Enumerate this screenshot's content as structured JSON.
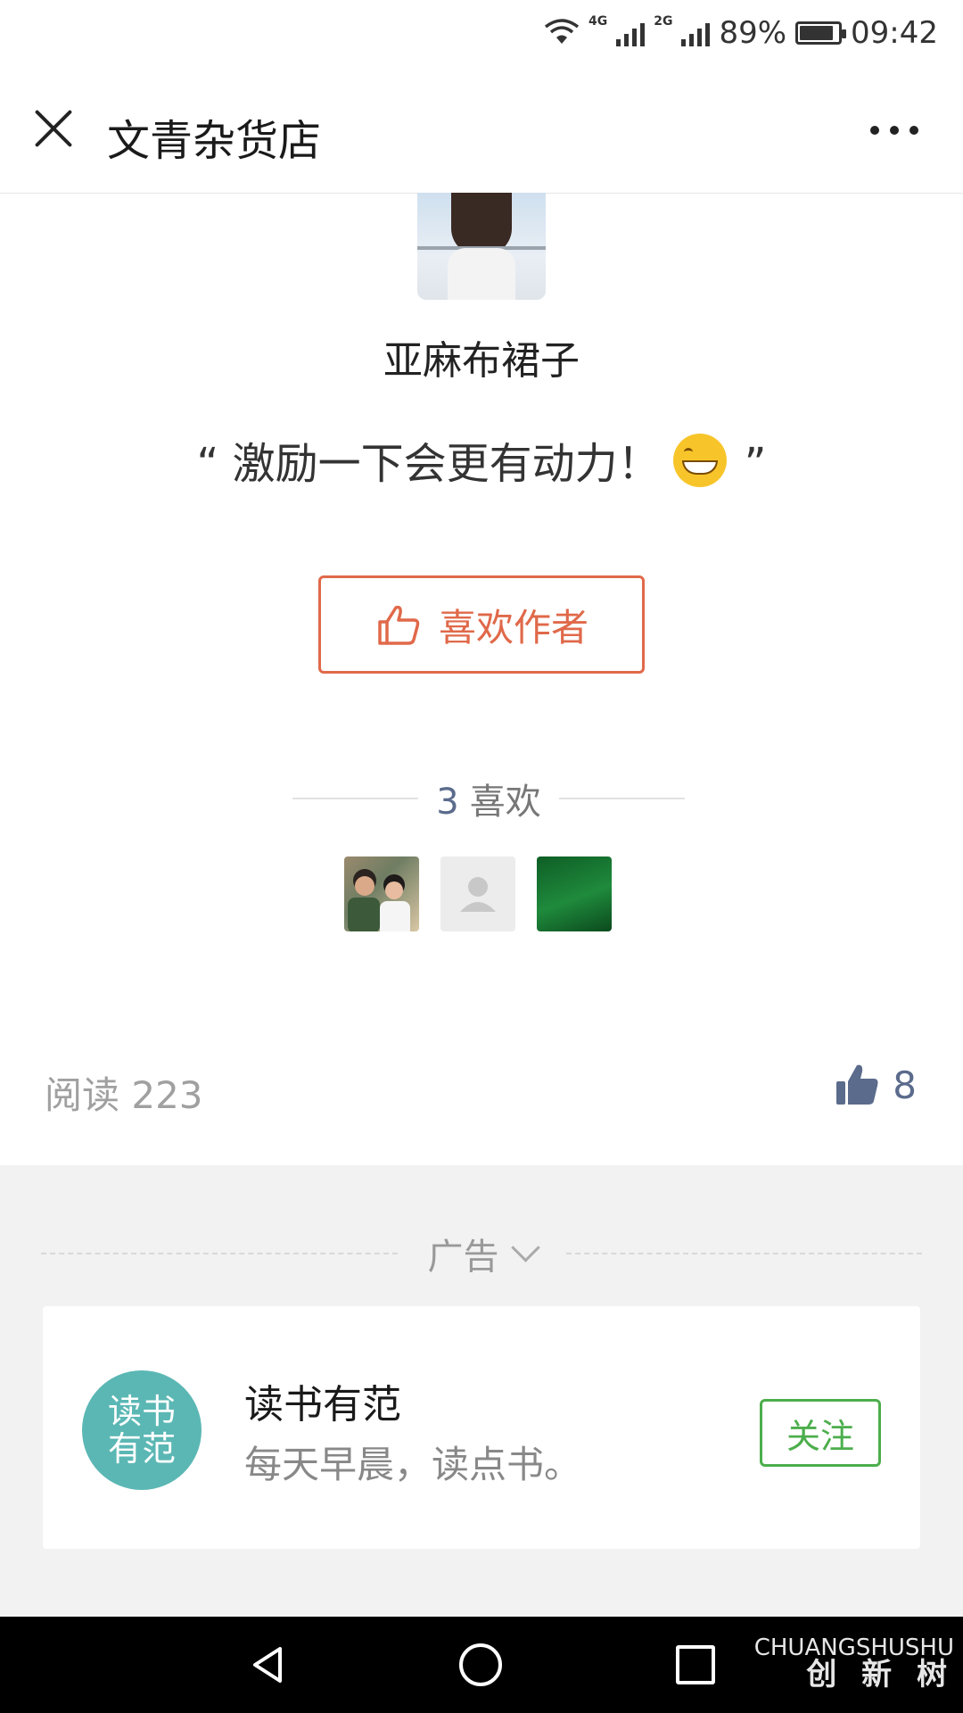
{
  "status_bar": {
    "network_1": "4G",
    "network_2": "2G",
    "battery": "89%",
    "battery_level": 0.89,
    "time": "09:42"
  },
  "header": {
    "title": "文青杂货店",
    "close_icon": "close-icon",
    "more_icon": "more-dots-icon"
  },
  "author": {
    "name": "亚麻布裙子",
    "quote": "“ 激励一下会更有动力！",
    "quote_end": "”",
    "emoji": "grinning-face-icon"
  },
  "like_author": {
    "label": "喜欢作者",
    "icon": "thumbs-up-outline-icon"
  },
  "likes": {
    "count": "3",
    "label": "喜欢"
  },
  "stats": {
    "read_label": "阅读 223",
    "like_count": "8"
  },
  "ad": {
    "label": "广告",
    "logo_line1": "读书",
    "logo_line2": "有范",
    "name": "读书有范",
    "desc": "每天早晨，读点书。",
    "follow_label": "关注"
  },
  "watermark": {
    "line1": "CHUANGSHUSHU",
    "line2": "创 新 树"
  },
  "colors": {
    "accent_orange": "#e0694a",
    "accent_green": "#4cae4c",
    "link_blue": "#5b6b8c",
    "ad_logo": "#5bb7b4"
  }
}
